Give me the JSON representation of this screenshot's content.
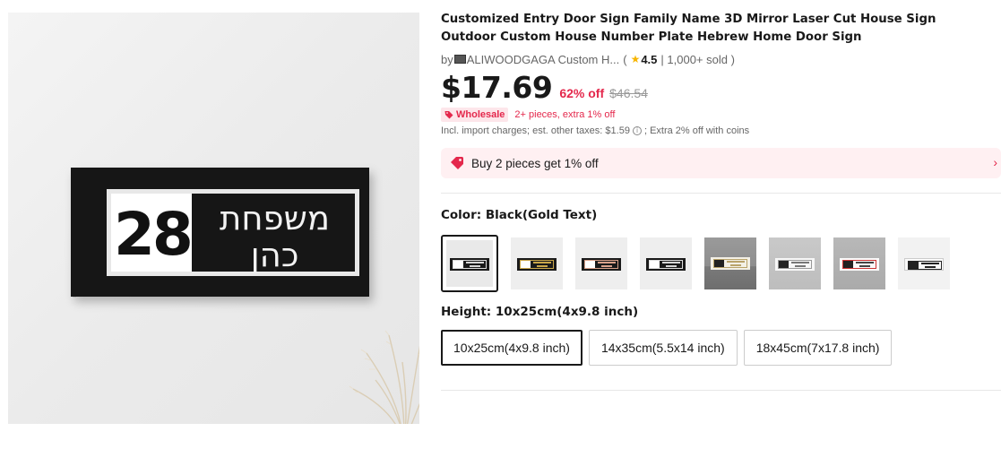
{
  "product": {
    "title": "Customized Entry Door Sign Family Name 3D Mirror Laser Cut House Sign Outdoor Custom House Number Plate Hebrew Home Door Sign",
    "by_label": "by",
    "store_name": "ALIWOODGAGA Custom H...",
    "rating_open": "(",
    "rating": "4.5",
    "sold": "| 1,000+ sold )",
    "price": "$17.69",
    "discount": "62% off",
    "original_price": "$46.54",
    "wholesale_badge": "Wholesale",
    "wholesale_text": "2+ pieces, extra 1% off",
    "tax_text_1": "Incl. import charges; est. other taxes: $1.59",
    "tax_text_2": "; Extra 2% off with coins",
    "promo_text": "Buy 2 pieces get 1% off"
  },
  "image": {
    "sign_number": "28",
    "sign_line1": "משפחת",
    "sign_line2": "כהן"
  },
  "options": {
    "color_label": "Color: Black(Gold Text)",
    "color_swatch_count": 8,
    "height_label": "Height: 10x25cm(4x9.8 inch)",
    "sizes": [
      "10x25cm(4x9.8 inch)",
      "14x35cm(5.5x14 inch)",
      "18x45cm(7x17.8 inch)"
    ]
  },
  "colors": {
    "accent": "#e4284c",
    "promo_bg": "#fff0f2",
    "star": "#f7b500"
  },
  "icons": {
    "star": "star-icon",
    "tag": "tag-icon",
    "info": "info-icon",
    "promo": "coupon-tag-icon",
    "chevron": "chevron-right-icon"
  }
}
